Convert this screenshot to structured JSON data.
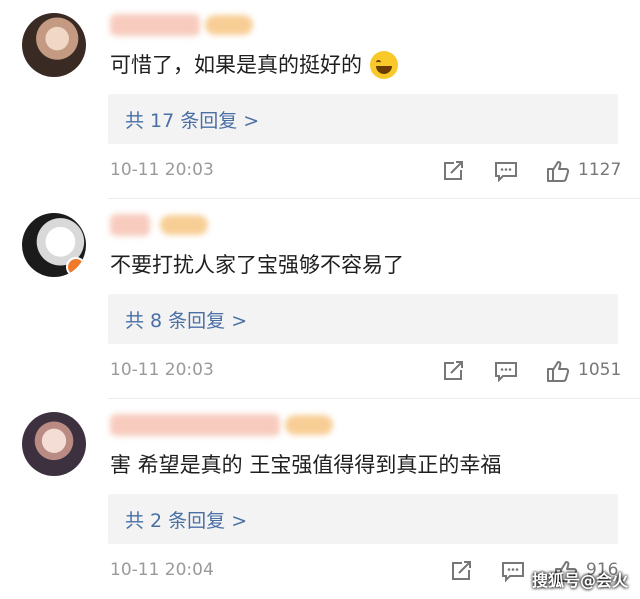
{
  "comments": [
    {
      "text": "可惜了，如果是真的挺好的",
      "has_emoji": true,
      "replies_label": "共 17 条回复 >",
      "time": "10-11 20:03",
      "likes": "1127"
    },
    {
      "text": "不要打扰人家了宝强够不容易了",
      "has_emoji": false,
      "replies_label": "共 8 条回复 >",
      "time": "10-11 20:03",
      "likes": "1051"
    },
    {
      "text": "害 希望是真的 王宝强值得得到真正的幸福",
      "has_emoji": false,
      "replies_label": "共 2 条回复 >",
      "time": "10-11 20:04",
      "likes": "916"
    }
  ],
  "watermark": "搜狐号@会火",
  "colors": {
    "reply_link": "#4a6fa5",
    "meta_text": "#9a9a9a",
    "reply_box_bg": "#f3f3f3"
  },
  "icons": [
    "share-icon",
    "comment-icon",
    "like-icon"
  ]
}
